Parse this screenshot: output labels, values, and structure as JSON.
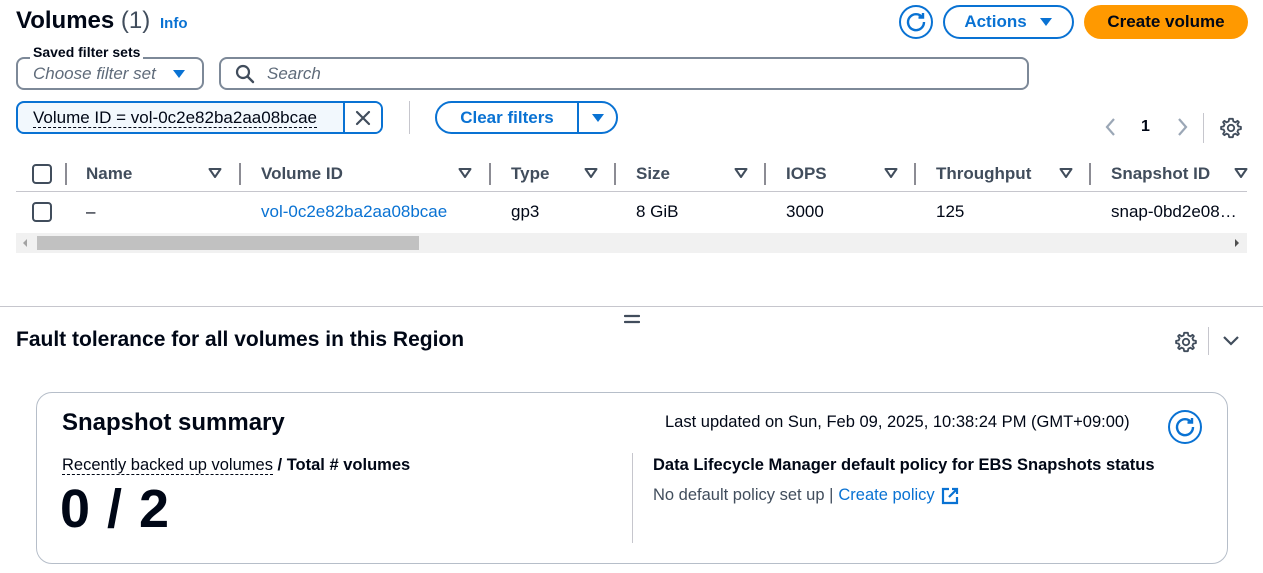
{
  "header": {
    "title": "Volumes",
    "count": "(1)",
    "info_link": "Info",
    "actions_label": "Actions",
    "create_label": "Create volume"
  },
  "filters": {
    "saved_filter_sets_label": "Saved filter sets",
    "saved_filter_sets_placeholder": "Choose filter set",
    "search_placeholder": "Search",
    "token_text": "Volume ID = vol-0c2e82ba2aa08bcae",
    "clear_filters_label": "Clear filters"
  },
  "pagination": {
    "current_page": "1"
  },
  "table": {
    "columns": [
      "Name",
      "Volume ID",
      "Type",
      "Size",
      "IOPS",
      "Throughput",
      "Snapshot ID"
    ],
    "rows": [
      {
        "name": "–",
        "volume_id": "vol-0c2e82ba2aa08bcae",
        "type": "gp3",
        "size": "8 GiB",
        "iops": "3000",
        "throughput": "125",
        "snapshot_id": "snap-0bd2e08…"
      }
    ]
  },
  "split_panel": {
    "title": "Fault tolerance for all volumes in this Region"
  },
  "snapshot_summary": {
    "title": "Snapshot summary",
    "last_updated": "Last updated on Sun, Feb 09, 2025, 10:38:24 PM (GMT+09:00)",
    "metric_label_part1": "Recently backed up volumes",
    "metric_label_part2": " / Total # volumes",
    "metric_value": "0 / 2",
    "dlm_title": "Data Lifecycle Manager default policy for EBS Snapshots status",
    "dlm_status_text": "No default policy set up |",
    "create_policy_link": "Create policy"
  },
  "colors": {
    "link_blue": "#0972d3",
    "primary_orange": "#ff9900",
    "text": "#000716",
    "border_gray": "#7d8998"
  },
  "icons": [
    "refresh-icon",
    "caret-down-icon",
    "search-icon",
    "close-icon",
    "chevron-left-icon",
    "chevron-right-icon",
    "gear-icon",
    "sort-caret-icon",
    "drag-handle-icon",
    "chevron-down-icon",
    "external-link-icon"
  ]
}
